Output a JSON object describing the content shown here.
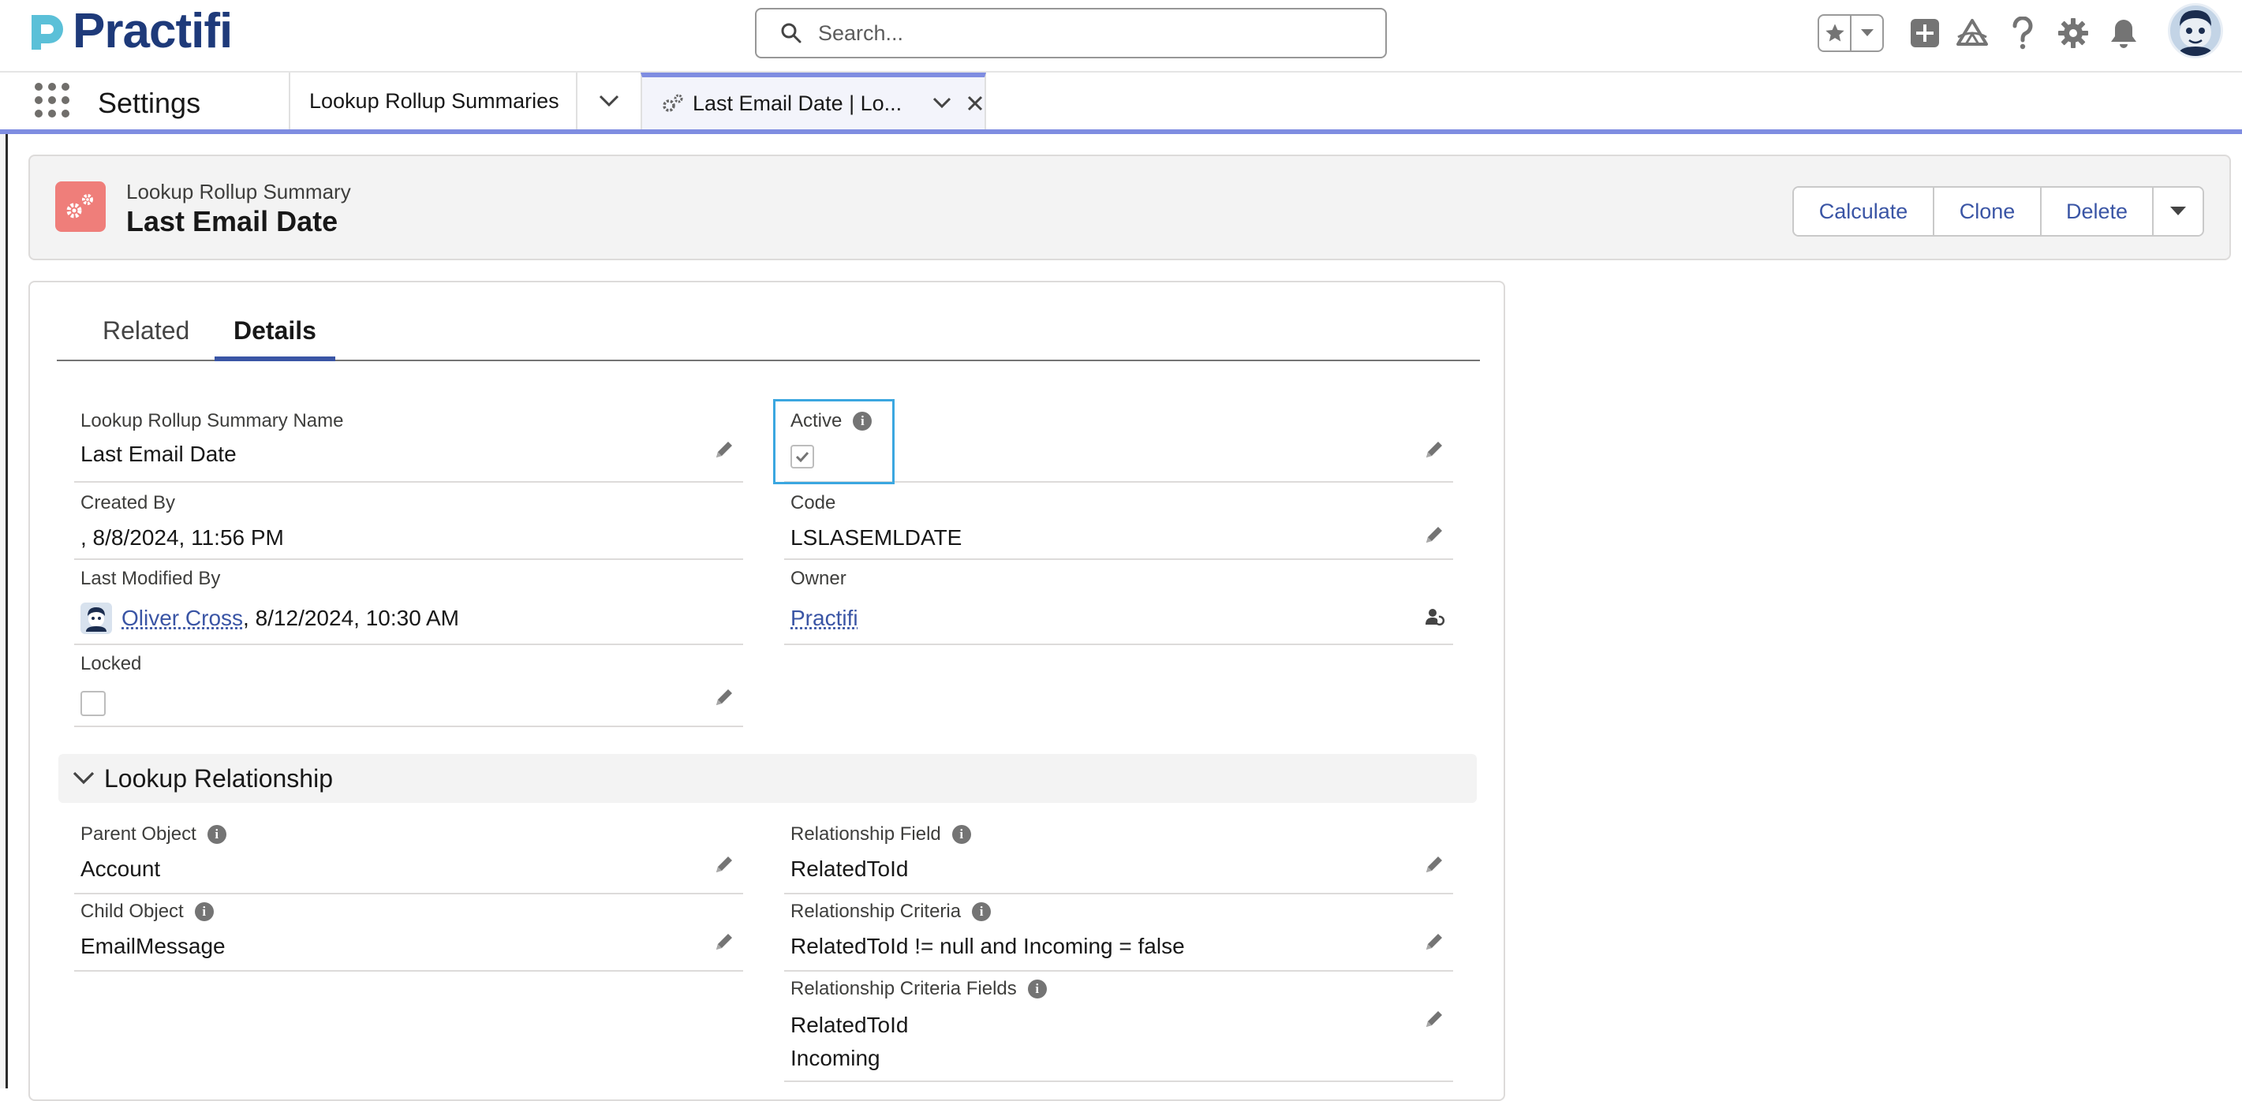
{
  "header": {
    "logo_text": "Practifi",
    "search_placeholder": "Search..."
  },
  "nav": {
    "app_name": "Settings",
    "tab1_label": "Lookup Rollup Summaries",
    "active_tab_label": "Last Email Date | Lo..."
  },
  "record": {
    "type_label": "Lookup Rollup Summary",
    "title": "Last Email Date",
    "buttons": {
      "calculate": "Calculate",
      "clone": "Clone",
      "delete": "Delete"
    }
  },
  "tabs": {
    "related": "Related",
    "details": "Details"
  },
  "fields": {
    "name_label": "Lookup Rollup Summary Name",
    "name_value": "Last Email Date",
    "active_label": "Active",
    "active_checked": true,
    "created_by_label": "Created By",
    "created_by_value": ", 8/8/2024, 11:56 PM",
    "code_label": "Code",
    "code_value": "LSLASEMLDATE",
    "modified_by_label": "Last Modified By",
    "modified_by_user": "Oliver Cross",
    "modified_by_date": ", 8/12/2024, 10:30 AM",
    "owner_label": "Owner",
    "owner_value": "Practifi",
    "locked_label": "Locked",
    "locked_checked": false
  },
  "lookup_section": {
    "title": "Lookup Relationship",
    "parent_object_label": "Parent Object",
    "parent_object_value": "Account",
    "relationship_field_label": "Relationship Field",
    "relationship_field_value": "RelatedToId",
    "child_object_label": "Child Object",
    "child_object_value": "EmailMessage",
    "relationship_criteria_label": "Relationship Criteria",
    "relationship_criteria_value": "RelatedToId != null and Incoming = false",
    "relationship_criteria_fields_label": "Relationship Criteria Fields",
    "relationship_criteria_fields_values": [
      "RelatedToId",
      "Incoming"
    ]
  },
  "colors": {
    "brand_blue": "#1e3a7a",
    "brand_teal": "#5bc0d8",
    "link_blue": "#3a55a5",
    "record_icon": "#ef7e7a",
    "nav_accent": "#7f8de1",
    "highlight": "#3ba7e0"
  }
}
